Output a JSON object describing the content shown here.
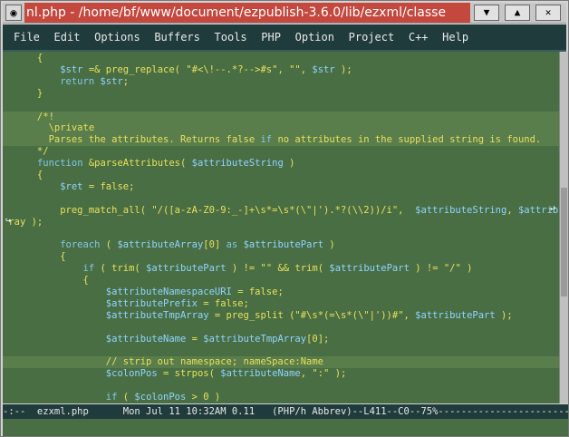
{
  "window": {
    "title": "nl.php - /home/bf/www/document/ezpublish-3.6.0/lib/ezxml/classe",
    "menu_icon": "circle-dot-icon",
    "min_icon": "chevron-down-icon",
    "max_icon": "chevron-up-icon",
    "close_icon": "close-icon"
  },
  "menubar": {
    "items": [
      "File",
      "Edit",
      "Options",
      "Buffers",
      "Tools",
      "PHP",
      "Option",
      "Project",
      "C++",
      "Help"
    ]
  },
  "editor": {
    "lines": [
      "      {",
      "          $str =& preg_replace( \"#<\\!--.*?-->#s\", \"\", $str );",
      "          return $str;",
      "      }",
      "",
      "      /*!",
      "        \\private",
      "        Parses the attributes. Returns false if no attributes in the supplied string is found.",
      "      */",
      "      function &parseAttributes( $attributeString )",
      "      {",
      "          $ret = false;",
      "",
      "          preg_match_all( \"/([a-zA-Z0-9:_-]+\\s*=\\s*(\\\"|').*?(\\\\2))/i\",  $attributeString, $attributeAr",
      " ray );",
      "",
      "          foreach ( $attributeArray[0] as $attributePart )",
      "          {",
      "              if ( trim( $attributePart ) != \"\" && trim( $attributePart ) != \"/\" )",
      "              {",
      "                  $attributeNamespaceURI = false;",
      "                  $attributePrefix = false;",
      "                  $attributeTmpArray = preg_split (\"#\\s*(=\\s*(\\\"|'))#\", $attributePart );",
      "",
      "                  $attributeName = $attributeTmpArray[0];",
      "",
      "                  // strip out namespace; nameSpace:Name",
      "                  $colonPos = strpos( $attributeName, \":\" );",
      "",
      "                  if ( $colonPos > 0 )"
    ],
    "highlighted_lines": [
      5,
      6,
      7,
      26
    ],
    "wrap_icon": "wrap-arrow-icon",
    "continuation_icon": "continuation-arrow-icon"
  },
  "modeline": {
    "text": "-:--  ezxml.php      Mon Jul 11 10:32AM 0.11   (PHP/h Abbrev)--L411--C0--75%-----------------------------"
  }
}
